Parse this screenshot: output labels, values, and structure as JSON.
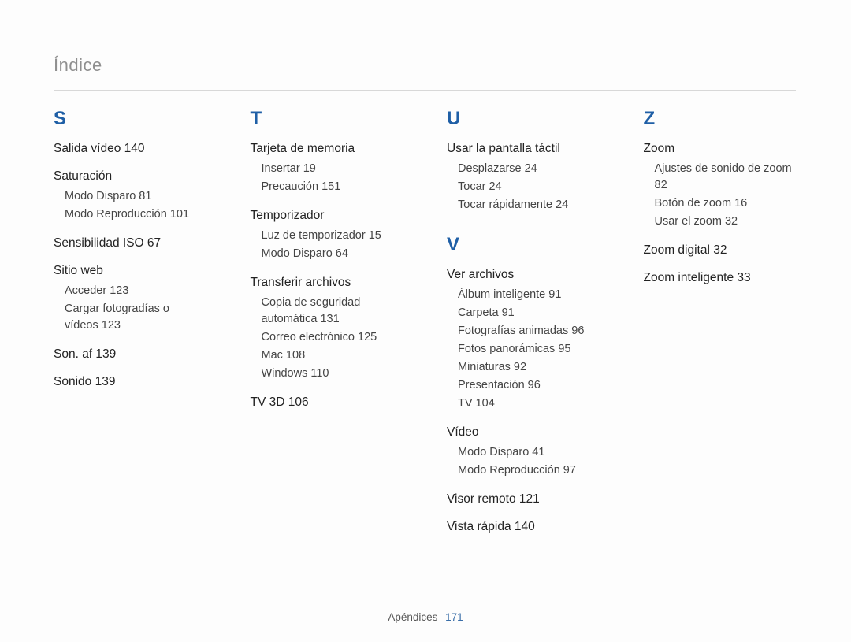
{
  "header": "Índice",
  "footer": {
    "section": "Apéndices",
    "page": "171"
  },
  "cols": [
    {
      "letters": [
        {
          "letter": "S",
          "entries": [
            {
              "label": "Salida vídeo",
              "page": "140"
            },
            {
              "label": "Saturación",
              "subs": [
                {
                  "label": "Modo Disparo",
                  "page": "81"
                },
                {
                  "label": "Modo Reproducción",
                  "page": "101"
                }
              ]
            },
            {
              "label": "Sensibilidad ISO",
              "page": "67"
            },
            {
              "label": "Sitio web",
              "subs": [
                {
                  "label": "Acceder",
                  "page": "123"
                },
                {
                  "label": "Cargar fotogradías o vídeos",
                  "page": "123"
                }
              ]
            },
            {
              "label": "Son. af",
              "page": "139"
            },
            {
              "label": "Sonido",
              "page": "139"
            }
          ]
        }
      ]
    },
    {
      "letters": [
        {
          "letter": "T",
          "entries": [
            {
              "label": "Tarjeta de memoria",
              "subs": [
                {
                  "label": "Insertar",
                  "page": "19"
                },
                {
                  "label": "Precaución",
                  "page": "151"
                }
              ]
            },
            {
              "label": "Temporizador",
              "subs": [
                {
                  "label": "Luz de temporizador",
                  "page": "15"
                },
                {
                  "label": "Modo Disparo",
                  "page": "64"
                }
              ]
            },
            {
              "label": "Transferir archivos",
              "subs": [
                {
                  "label": "Copia de seguridad automática",
                  "page": "131"
                },
                {
                  "label": "Correo electrónico",
                  "page": "125"
                },
                {
                  "label": "Mac",
                  "page": "108"
                },
                {
                  "label": "Windows",
                  "page": "110"
                }
              ]
            },
            {
              "label": "TV 3D",
              "page": "106"
            }
          ]
        }
      ]
    },
    {
      "letters": [
        {
          "letter": "U",
          "entries": [
            {
              "label": "Usar la pantalla táctil",
              "subs": [
                {
                  "label": "Desplazarse",
                  "page": "24"
                },
                {
                  "label": "Tocar",
                  "page": "24"
                },
                {
                  "label": "Tocar rápidamente",
                  "page": "24"
                }
              ]
            }
          ]
        },
        {
          "letter": "V",
          "entries": [
            {
              "label": "Ver archivos",
              "subs": [
                {
                  "label": "Álbum inteligente",
                  "page": "91"
                },
                {
                  "label": "Carpeta",
                  "page": "91"
                },
                {
                  "label": "Fotografías animadas",
                  "page": "96"
                },
                {
                  "label": "Fotos panorámicas",
                  "page": "95"
                },
                {
                  "label": "Miniaturas",
                  "page": "92"
                },
                {
                  "label": "Presentación",
                  "page": "96"
                },
                {
                  "label": "TV",
                  "page": "104"
                }
              ]
            },
            {
              "label": "Vídeo",
              "subs": [
                {
                  "label": "Modo Disparo",
                  "page": "41"
                },
                {
                  "label": "Modo Reproducción",
                  "page": "97"
                }
              ]
            },
            {
              "label": "Visor remoto",
              "page": "121"
            },
            {
              "label": "Vista rápida",
              "page": "140"
            }
          ]
        }
      ]
    },
    {
      "letters": [
        {
          "letter": "Z",
          "entries": [
            {
              "label": "Zoom",
              "subs": [
                {
                  "label": "Ajustes de sonido de zoom",
                  "page": "82"
                },
                {
                  "label": "Botón de zoom",
                  "page": "16"
                },
                {
                  "label": "Usar el zoom",
                  "page": "32"
                }
              ]
            },
            {
              "label": "Zoom digital",
              "page": "32"
            },
            {
              "label": "Zoom inteligente",
              "page": "33"
            }
          ]
        }
      ]
    }
  ]
}
